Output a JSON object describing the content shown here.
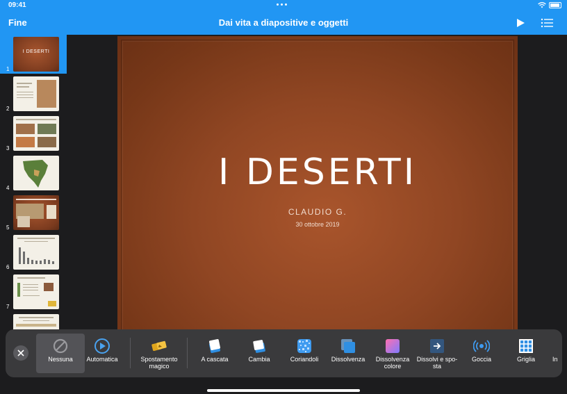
{
  "status": {
    "time": "09:41"
  },
  "nav": {
    "done": "Fine",
    "title": "Dai vita a diapositive e oggetti"
  },
  "slides": {
    "thumb_numbers": [
      "1",
      "2",
      "3",
      "4",
      "5",
      "6",
      "7"
    ],
    "thumb1_title": "I DESERTI"
  },
  "slide": {
    "title": "I DESERTI",
    "author": "CLAUDIO G.",
    "date": "30 ottobre 2019"
  },
  "transitions": {
    "items": [
      {
        "label": "Nessuna",
        "icon": "none-icon"
      },
      {
        "label": "Automatica",
        "icon": "auto-play-icon"
      },
      {
        "label": "Spostamento magico",
        "icon": "magic-move-icon"
      },
      {
        "label": "A cascata",
        "icon": "cascade-icon"
      },
      {
        "label": "Cambia",
        "icon": "flip-icon"
      },
      {
        "label": "Coriandoli",
        "icon": "confetti-icon"
      },
      {
        "label": "Dissolvenza",
        "icon": "dissolve-icon"
      },
      {
        "label": "Dissolvenza colore",
        "icon": "color-dissolve-icon"
      },
      {
        "label": "Dissolvi e spo-sta",
        "icon": "dissolve-move-icon"
      },
      {
        "label": "Goccia",
        "icon": "droplet-icon"
      },
      {
        "label": "Griglia",
        "icon": "grid-icon"
      },
      {
        "label": "In",
        "icon": "partial-icon"
      }
    ],
    "selected": "Nessuna"
  },
  "colors": {
    "accent": "#2196f3",
    "tray": "#3a3a3c",
    "slide_brown": "#8e4421"
  }
}
